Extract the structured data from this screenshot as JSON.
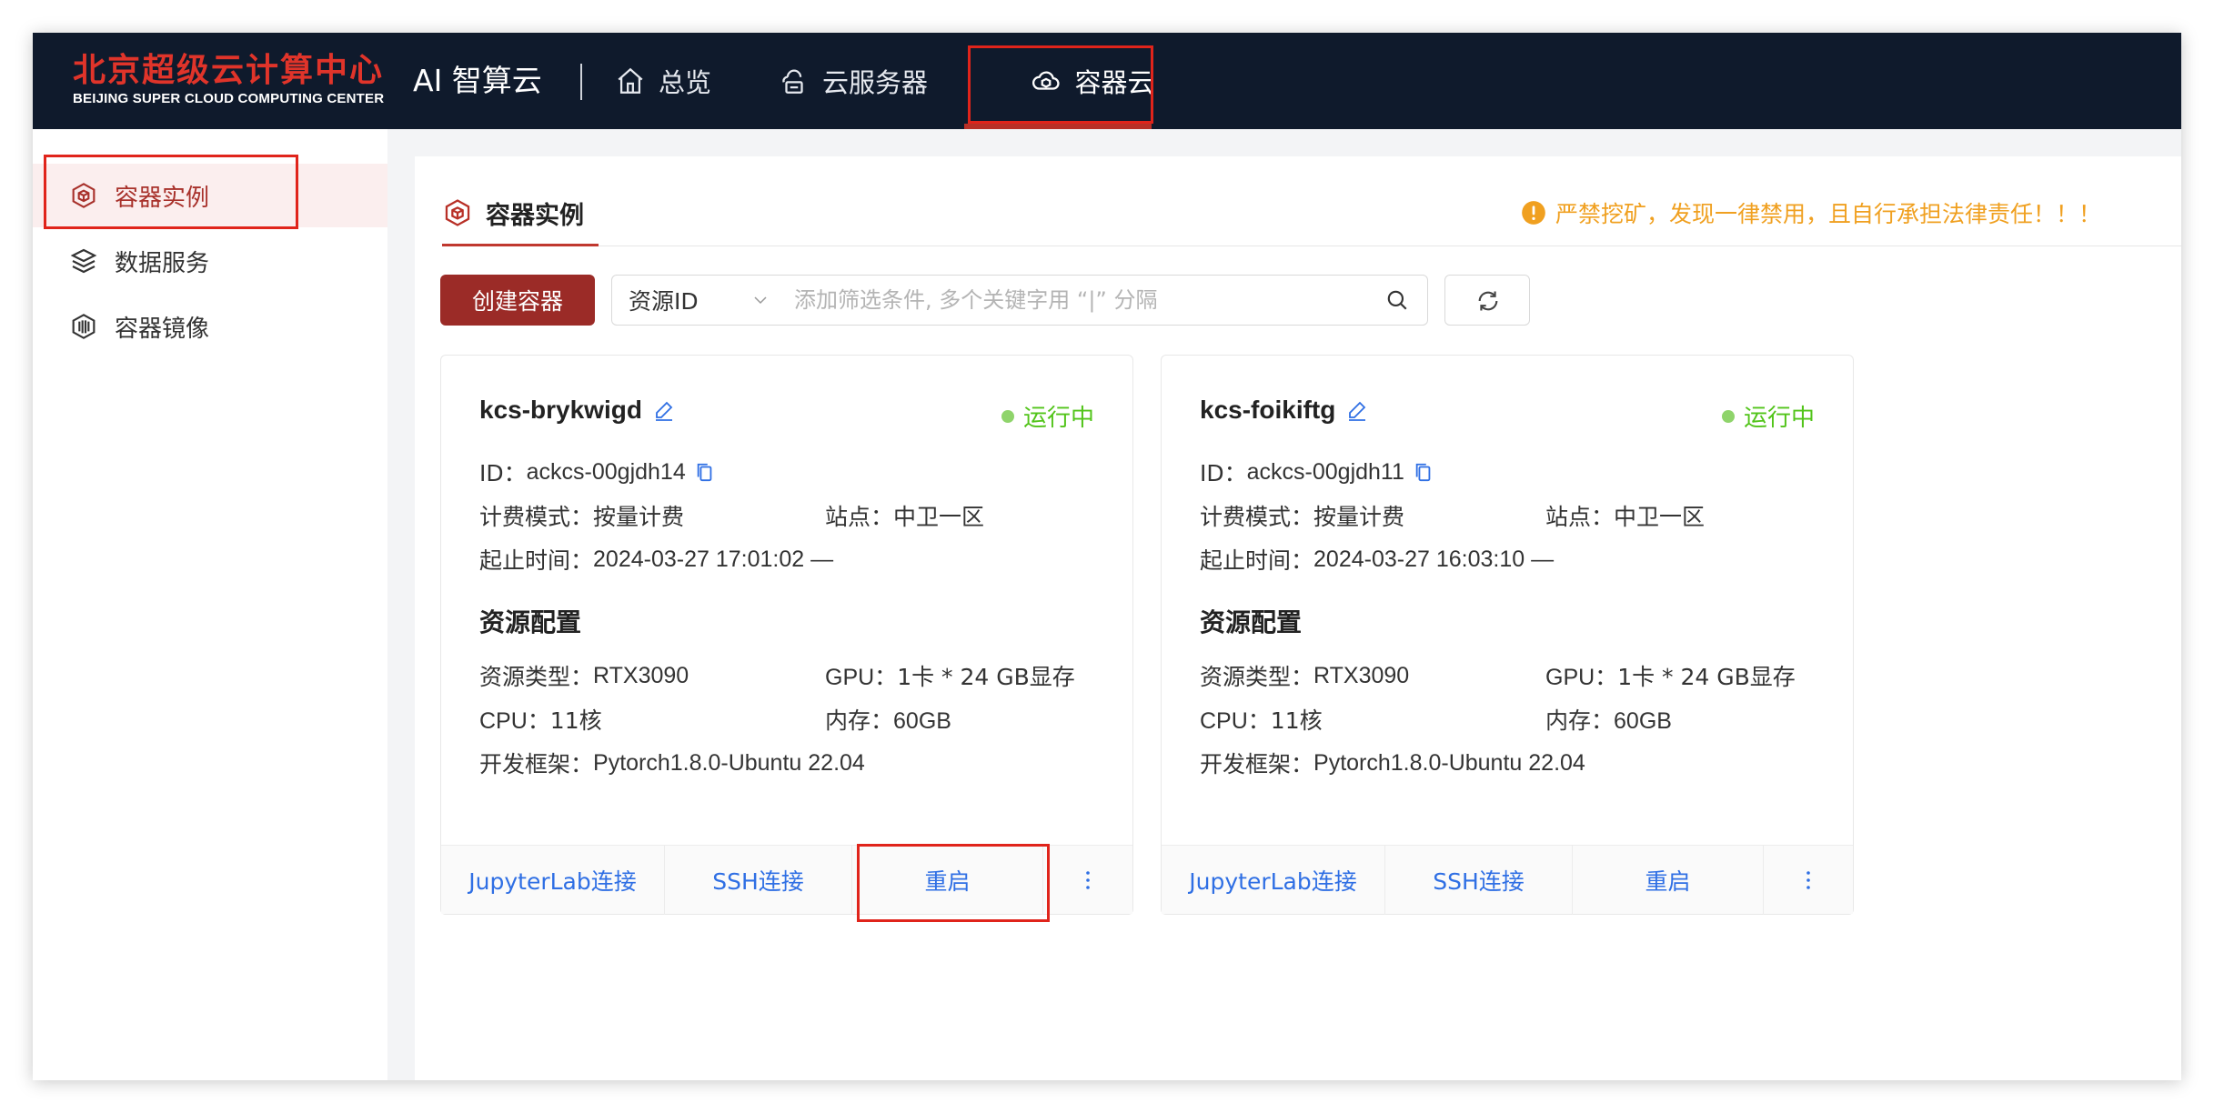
{
  "header": {
    "logo_cn": "北京超级云计算中心",
    "logo_en": "BEIJING SUPER CLOUD COMPUTING CENTER",
    "product": "AI 智算云",
    "nav": [
      {
        "label": "总览",
        "icon": "home-icon"
      },
      {
        "label": "云服务器",
        "icon": "cloud-server-icon"
      },
      {
        "label": "容器云",
        "icon": "container-cloud-icon",
        "active": true
      }
    ]
  },
  "sidebar": {
    "items": [
      {
        "label": "容器实例",
        "icon": "container-instance-icon",
        "active": true
      },
      {
        "label": "数据服务",
        "icon": "layers-icon"
      },
      {
        "label": "容器镜像",
        "icon": "image-cube-icon"
      }
    ]
  },
  "main": {
    "tab": "容器实例",
    "warning": "严禁挖矿，发现一律禁用，且自行承担法律责任！！！",
    "create_button": "创建容器",
    "filter_select": "资源ID",
    "filter_placeholder": "添加筛选条件, 多个关键字用 “|” 分隔",
    "cards": [
      {
        "name": "kcs-brykwigd",
        "status": "运行中",
        "id_label": "ID：",
        "id": "ackcs-00gjdh14",
        "billing_label": "计费模式：",
        "billing": "按量计费",
        "site_label": "站点：",
        "site": "中卫一区",
        "time_label": "起止时间：",
        "time": "2024-03-27 17:01:02 —",
        "section": "资源配置",
        "type_label": "资源类型：",
        "type": "RTX3090",
        "gpu_label": "GPU：",
        "gpu": "1卡 * 24 GB显存",
        "cpu_label": "CPU：",
        "cpu": "11核",
        "mem_label": "内存：",
        "mem": "60GB",
        "framework_label": "开发框架：",
        "framework": "Pytorch1.8.0-Ubuntu 22.04",
        "actions": [
          "JupyterLab连接",
          "SSH连接",
          "重启"
        ]
      },
      {
        "name": "kcs-foikiftg",
        "status": "运行中",
        "id_label": "ID：",
        "id": "ackcs-00gjdh11",
        "billing_label": "计费模式：",
        "billing": "按量计费",
        "site_label": "站点：",
        "site": "中卫一区",
        "time_label": "起止时间：",
        "time": "2024-03-27 16:03:10 —",
        "section": "资源配置",
        "type_label": "资源类型：",
        "type": "RTX3090",
        "gpu_label": "GPU：",
        "gpu": "1卡 * 24 GB显存",
        "cpu_label": "CPU：",
        "cpu": "11核",
        "mem_label": "内存：",
        "mem": "60GB",
        "framework_label": "开发框架：",
        "framework": "Pytorch1.8.0-Ubuntu 22.04",
        "actions": [
          "JupyterLab连接",
          "SSH连接",
          "重启"
        ]
      }
    ]
  },
  "colors": {
    "topbar": "#0f1a2c",
    "brand_red": "#9b2b27",
    "highlight_box": "#e0241b",
    "status_green": "#52c41a",
    "link_blue": "#2f6fe4",
    "warning_orange": "#f0a020"
  }
}
